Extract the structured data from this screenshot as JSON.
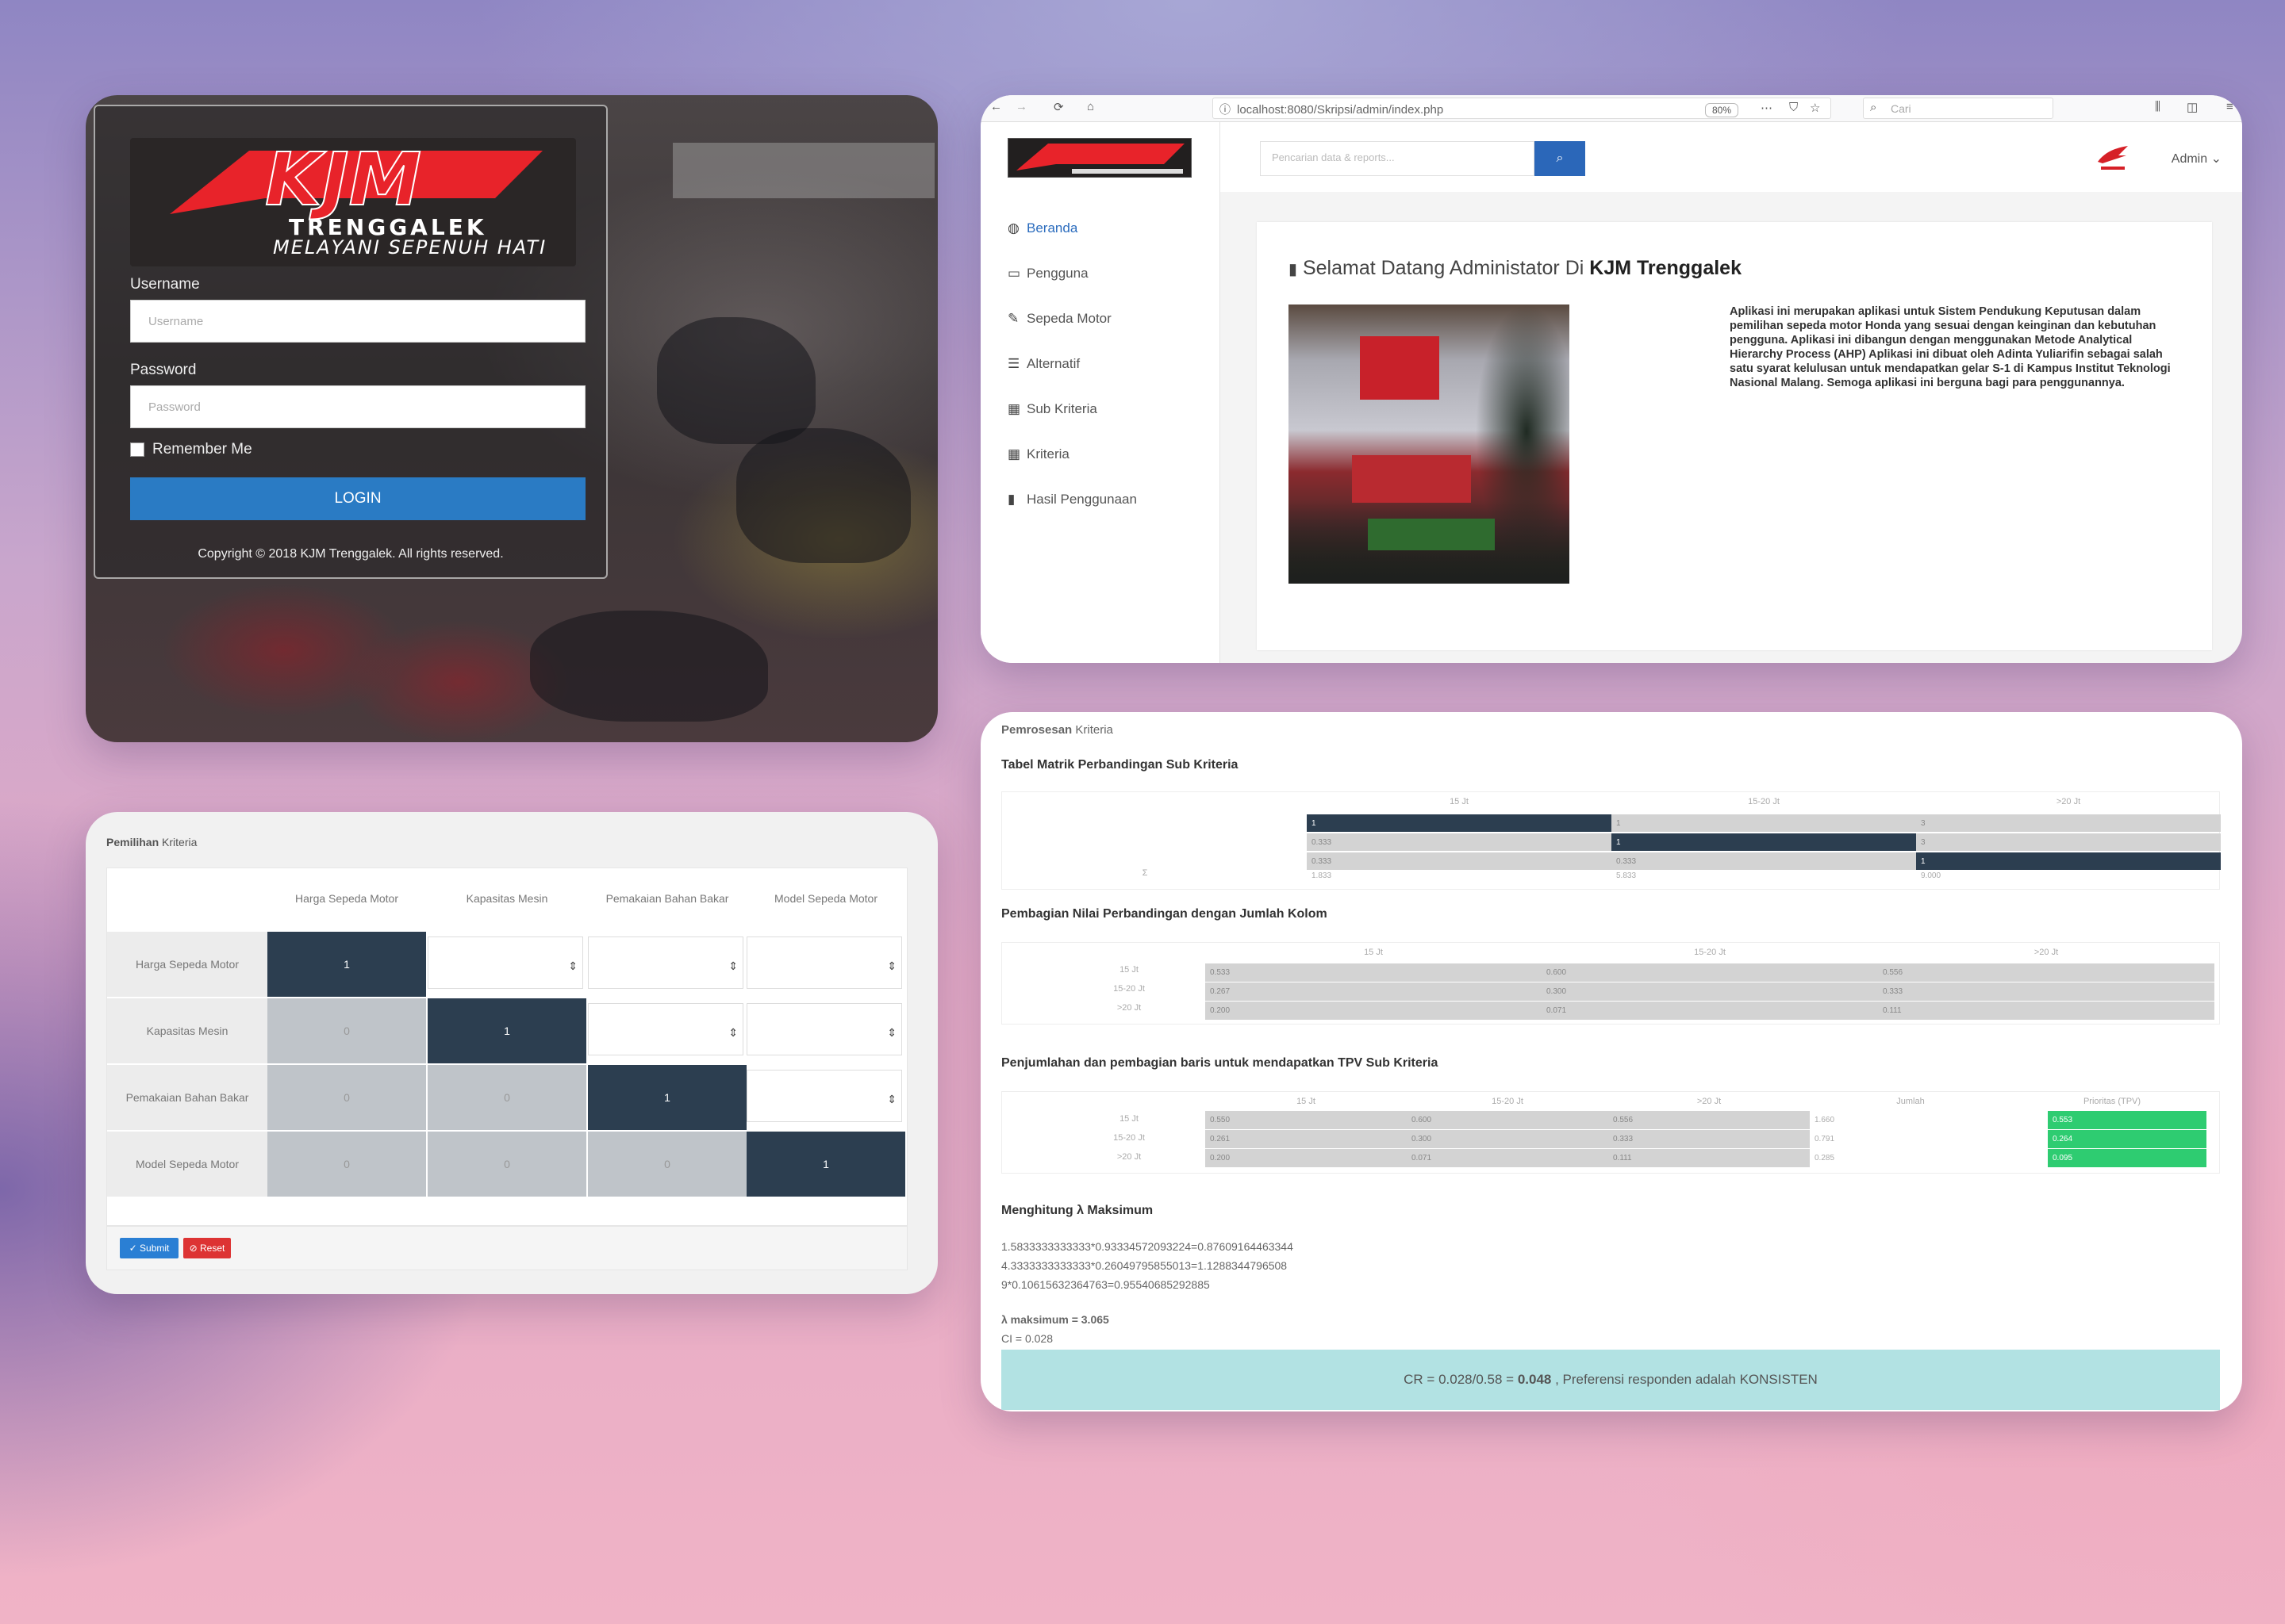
{
  "login": {
    "logo_text": "KJM",
    "logo_sub": "TRENGGALEK",
    "tagline": "MELAYANI SEPENUH HATI",
    "username_label": "Username",
    "username_placeholder": "Username",
    "password_label": "Password",
    "password_placeholder": "Password",
    "remember_label": "Remember Me",
    "login_button": "LOGIN",
    "copyright": "Copyright © 2018 KJM Trenggalek. All rights reserved."
  },
  "browser": {
    "url": "localhost:8080/Skripsi/admin/index.php",
    "zoom": "80%",
    "search_placeholder": "Cari"
  },
  "dashboard": {
    "search_placeholder": "Pencarian data & reports...",
    "admin_label": "Admin",
    "nav": [
      {
        "label": "Beranda",
        "icon": "dashboard-icon",
        "active": true
      },
      {
        "label": "Pengguna",
        "icon": "monitor-icon"
      },
      {
        "label": "Sepeda Motor",
        "icon": "edit-icon"
      },
      {
        "label": "Alternatif",
        "icon": "list-icon"
      },
      {
        "label": "Sub Kriteria",
        "icon": "table-icon"
      },
      {
        "label": "Kriteria",
        "icon": "table-icon"
      },
      {
        "label": "Hasil Penggunaan",
        "icon": "book-icon"
      }
    ],
    "welcome_prefix": "Selamat Datang Administator Di",
    "welcome_brand": "KJM Trenggalek",
    "description": "Aplikasi ini merupakan aplikasi untuk Sistem Pendukung Keputusan dalam pemilihan sepeda motor Honda yang sesuai dengan keinginan dan kebutuhan pengguna. Aplikasi ini dibangun dengan menggunakan Metode Analytical Hierarchy Process (AHP) Aplikasi ini dibuat oleh Adinta Yuliarifin sebagai salah satu syarat kelulusan untuk mendapatkan gelar S-1 di Kampus Institut Teknologi Nasional Malang. Semoga aplikasi ini berguna bagi para penggunannya."
  },
  "pemilihan": {
    "title_bold": "Pemilihan",
    "title_rest": "Kriteria",
    "headers": [
      "Harga Sepeda Motor",
      "Kapasitas Mesin",
      "Pemakaian Bahan Bakar",
      "Model Sepeda Motor"
    ],
    "rows": [
      "Harga Sepeda Motor",
      "Kapasitas Mesin",
      "Pemakaian Bahan Bakar",
      "Model Sepeda Motor"
    ],
    "diag": "1",
    "lower": "0",
    "submit": "Submit",
    "reset": "Reset"
  },
  "proses": {
    "title_bold": "Pemrosesan",
    "title_rest": "Kriteria",
    "sec1": "Tabel Matrik Perbandingan Sub Kriteria",
    "sec2": "Pembagian Nilai Perbandingan dengan Jumlah Kolom",
    "sec3": "Penjumlahan dan pembagian baris untuk mendapatkan TPV Sub Kriteria",
    "sec4": "Menghitung λ Maksimum",
    "cols": [
      "15 Jt",
      "15-20 Jt",
      ">20 Jt"
    ],
    "sum_label": "Jumlah",
    "prio_label": "Prioritas (TPV)",
    "m1_rows": [
      [
        "1",
        "1",
        "3"
      ],
      [
        "0.333",
        "1",
        "3"
      ],
      [
        "0.333",
        "0.333",
        "1"
      ]
    ],
    "m1_sum": [
      "1.833",
      "5.833",
      "9.000"
    ],
    "sum_row_label": "Σ",
    "m2_rows": [
      [
        "0.533",
        "0.600",
        "0.556"
      ],
      [
        "0.267",
        "0.300",
        "0.333"
      ],
      [
        "0.200",
        "0.071",
        "0.111"
      ]
    ],
    "m3_rows": [
      [
        "0.550",
        "0.600",
        "0.556",
        "1.660",
        "0.553"
      ],
      [
        "0.261",
        "0.300",
        "0.333",
        "0.791",
        "0.264"
      ],
      [
        "0.200",
        "0.071",
        "0.111",
        "0.285",
        "0.095"
      ]
    ],
    "lambda_lines": [
      "1.5833333333333*0.93334572093224=0.87609164463344",
      "4.3333333333333*0.26049795855013=1.1288344796508",
      "9*0.10615632364763=0.95540685292885"
    ],
    "lambda_max_label": "λ maksimum = 3.065",
    "ci": "CI = 0.028",
    "cr_prefix": "CR = 0.028/0.58 =",
    "cr_value": "0.048",
    "cr_suffix": ", Preferensi responden adalah KONSISTEN"
  },
  "colors": {
    "dark": "#2c3e50",
    "primary": "#2a7bc4",
    "green": "#2ecc71",
    "cr_bg": "#b2e2e3"
  }
}
